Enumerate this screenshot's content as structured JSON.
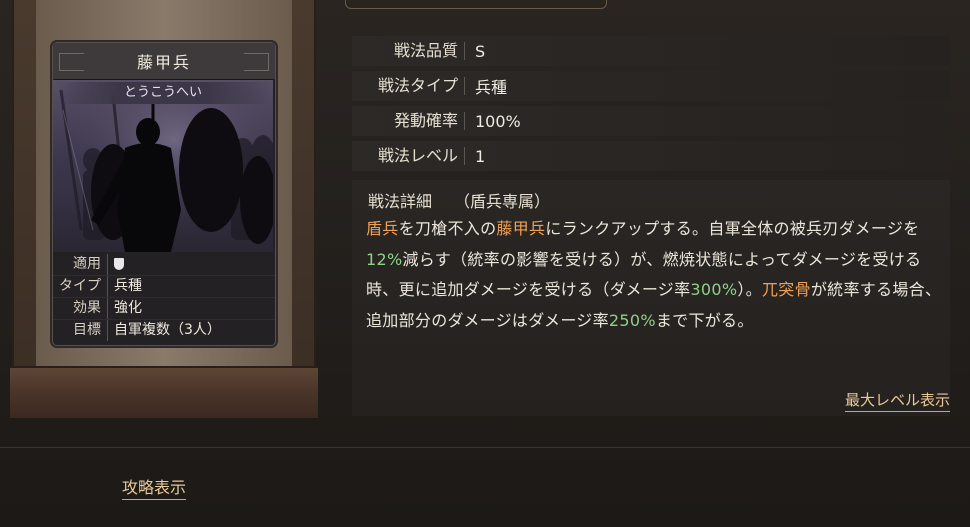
{
  "card": {
    "name": "藤甲兵",
    "reading": "とうこうへい",
    "rows": [
      {
        "key": "適用",
        "value": "",
        "icon": "shield-icon"
      },
      {
        "key": "タイプ",
        "value": "兵種"
      },
      {
        "key": "効果",
        "value": "強化"
      },
      {
        "key": "目標",
        "value": "自軍複数（3人）"
      }
    ]
  },
  "info": [
    {
      "key": "戦法品質",
      "value": "S"
    },
    {
      "key": "戦法タイプ",
      "value": "兵種"
    },
    {
      "key": "発動確率",
      "value": "100%"
    },
    {
      "key": "戦法レベル",
      "value": "1"
    }
  ],
  "detail": {
    "key": "戦法詳細",
    "note": "（盾兵専属）",
    "segments": [
      {
        "text": "盾兵",
        "style": "orange"
      },
      {
        "text": "を刀槍不入の",
        "style": ""
      },
      {
        "text": "藤甲兵",
        "style": "orange"
      },
      {
        "text": "にランクアップする。自軍全体の被兵刃ダメージを",
        "style": ""
      },
      {
        "text": "12%",
        "style": "green"
      },
      {
        "text": "減らす（統率の影響を受ける）が、燃焼状態によってダメージを受ける時、更に追加ダメージを受ける（ダメージ率",
        "style": ""
      },
      {
        "text": "300%",
        "style": "green"
      },
      {
        "text": "）。",
        "style": ""
      },
      {
        "text": "兀突骨",
        "style": "orange"
      },
      {
        "text": "が統率する場合、追加部分のダメージはダメージ率",
        "style": ""
      },
      {
        "text": "250%",
        "style": "green"
      },
      {
        "text": "まで下がる。",
        "style": ""
      }
    ],
    "max_level_label": "最大レベル表示"
  },
  "footer": {
    "guide_label": "攻略表示"
  },
  "colors": {
    "highlight_orange": "#f0a055",
    "highlight_green": "#8fd08a",
    "link": "#e8c99a"
  }
}
